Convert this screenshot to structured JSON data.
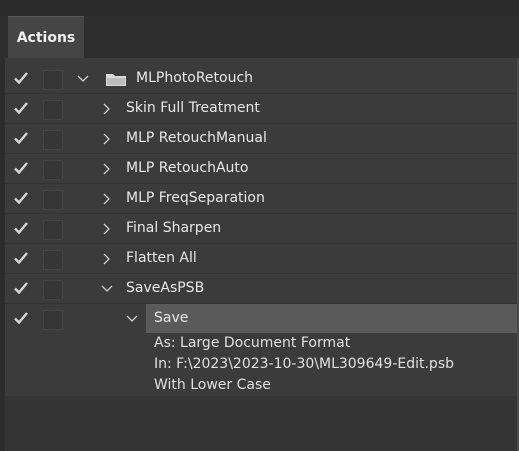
{
  "panel": {
    "tab_label": "Actions"
  },
  "rows": [
    {
      "label": "MLPhotoRetouch"
    },
    {
      "label": "Skin Full Treatment"
    },
    {
      "label": "MLP RetouchManual"
    },
    {
      "label": "MLP RetouchAuto"
    },
    {
      "label": "MLP FreqSeparation"
    },
    {
      "label": "Final Sharpen"
    },
    {
      "label": "Flatten All"
    },
    {
      "label": "SaveAsPSB"
    },
    {
      "label": "Save"
    }
  ],
  "save_details": [
    "As: Large Document Format",
    "In: F:\\2023\\2023-10-30\\ML309649-Edit.psb",
    "With Lower Case"
  ],
  "colors": {
    "background": "#3b3b3b",
    "selected_row": "#5a5a5a",
    "text": "#e8e8e8"
  }
}
